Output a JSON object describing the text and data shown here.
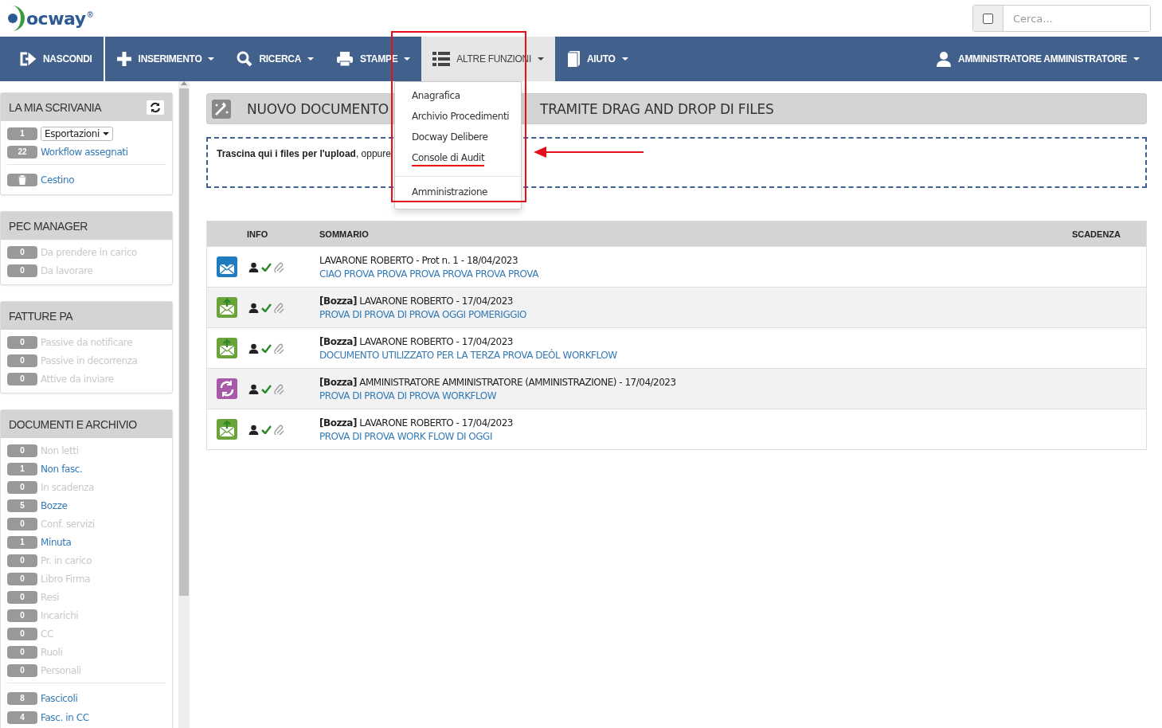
{
  "header": {
    "logo": "ocway",
    "logo_mark": "®",
    "search": {
      "placeholder": "Cerca...",
      "checked": false
    }
  },
  "nav": {
    "items": [
      {
        "label": "NASCONDI",
        "caret": false,
        "selected": false
      },
      {
        "label": "INSERIMENTO",
        "caret": true,
        "selected": false
      },
      {
        "label": "RICERCA",
        "caret": true,
        "selected": false
      },
      {
        "label": "STAMPE",
        "caret": true,
        "selected": false
      },
      {
        "label": "ALTRE FUNZIONI",
        "caret": true,
        "selected": true
      },
      {
        "label": "AIUTO",
        "caret": true,
        "selected": false
      }
    ],
    "user": {
      "label": "AMMINISTRATORE AMMINISTRATORE",
      "caret": true
    }
  },
  "menu": {
    "items": [
      {
        "label": "Anagrafica",
        "underlined": false,
        "divider_before": false
      },
      {
        "label": "Archivio Procedimenti",
        "underlined": false,
        "divider_before": false
      },
      {
        "label": "Docway Delibere",
        "underlined": false,
        "divider_before": false
      },
      {
        "label": "Console di Audit",
        "underlined": true,
        "divider_before": false
      },
      {
        "label": "Amministrazione",
        "underlined": false,
        "divider_before": true
      }
    ]
  },
  "sidebar": {
    "panels": [
      {
        "title": "LA MIA SCRIVANIA",
        "refresh": true,
        "items": [
          {
            "kind": "dropdown",
            "badge": "1",
            "label": "Esportazioni",
            "disabled": false,
            "divider_before": false
          },
          {
            "kind": "link",
            "badge": "22",
            "label": "Workflow assegnati",
            "disabled": false,
            "divider_before": false
          },
          {
            "kind": "trash",
            "label": "Cestino",
            "disabled": false,
            "divider_before": true
          }
        ]
      },
      {
        "title": "PEC MANAGER",
        "refresh": false,
        "items": [
          {
            "kind": "link",
            "badge": "0",
            "label": "Da prendere in carico",
            "disabled": true,
            "divider_before": false
          },
          {
            "kind": "link",
            "badge": "0",
            "label": "Da lavorare",
            "disabled": true,
            "divider_before": false
          }
        ]
      },
      {
        "title": "FATTURE PA",
        "refresh": false,
        "items": [
          {
            "kind": "link",
            "badge": "0",
            "label": "Passive da notificare",
            "disabled": true,
            "divider_before": false
          },
          {
            "kind": "link",
            "badge": "0",
            "label": "Passive in decorrenza",
            "disabled": true,
            "divider_before": false
          },
          {
            "kind": "link",
            "badge": "0",
            "label": "Attive da inviare",
            "disabled": true,
            "divider_before": false
          }
        ]
      },
      {
        "title": "DOCUMENTI E ARCHIVIO",
        "refresh": false,
        "items": [
          {
            "kind": "link",
            "badge": "0",
            "label": "Non letti",
            "disabled": true,
            "divider_before": false
          },
          {
            "kind": "link",
            "badge": "1",
            "label": "Non fasc.",
            "disabled": false,
            "divider_before": false
          },
          {
            "kind": "link",
            "badge": "0",
            "label": "In scadenza",
            "disabled": true,
            "divider_before": false
          },
          {
            "kind": "link",
            "badge": "5",
            "label": "Bozze",
            "disabled": false,
            "divider_before": false
          },
          {
            "kind": "link",
            "badge": "0",
            "label": "Conf. servizi",
            "disabled": true,
            "divider_before": false
          },
          {
            "kind": "link",
            "badge": "1",
            "label": "Minuta",
            "disabled": false,
            "divider_before": false
          },
          {
            "kind": "link",
            "badge": "0",
            "label": "Pr. in carico",
            "disabled": true,
            "divider_before": false
          },
          {
            "kind": "link",
            "badge": "0",
            "label": "Libro Firma",
            "disabled": true,
            "divider_before": false
          },
          {
            "kind": "link",
            "badge": "0",
            "label": "Resi",
            "disabled": true,
            "divider_before": false
          },
          {
            "kind": "link",
            "badge": "0",
            "label": "Incarichi",
            "disabled": true,
            "divider_before": false
          },
          {
            "kind": "link",
            "badge": "0",
            "label": "CC",
            "disabled": true,
            "divider_before": false
          },
          {
            "kind": "link",
            "badge": "0",
            "label": "Ruoli",
            "disabled": true,
            "divider_before": false
          },
          {
            "kind": "link",
            "badge": "0",
            "label": "Personali",
            "disabled": true,
            "divider_before": false
          },
          {
            "kind": "link",
            "badge": "8",
            "label": "Fascicoli",
            "disabled": false,
            "divider_before": true
          },
          {
            "kind": "link",
            "badge": "4",
            "label": "Fasc. in CC",
            "disabled": false,
            "divider_before": false
          }
        ]
      }
    ]
  },
  "title_bar": {
    "title_start": "NUOVO DOCUMENTO",
    "title_end": "TRAMITE DRAG AND DROP DI FILES"
  },
  "dropzone": {
    "text": "**Trascina qui i files per l'upload**, oppure"
  },
  "table": {
    "columns": [
      "INFO",
      "SOMMARIO",
      "SCADENZA"
    ],
    "rows": [
      {
        "kind": "incoming",
        "heading": "LAVARONE ROBERTO - Prot n. 1 - 18/04/2023",
        "subject": "CIAO PROVA PROVA PROVA PROVA PROVA PROVA"
      },
      {
        "kind": "draft",
        "heading": "**[Bozza]** LAVARONE ROBERTO - 17/04/2023",
        "subject": "PROVA DI PROVA DI PROVA OGGI POMERIGGIO"
      },
      {
        "kind": "draft",
        "heading": "**[Bozza]** LAVARONE ROBERTO - 17/04/2023",
        "subject": "DOCUMENTO UTILIZZATO PER LA TERZA PROVA DEÒL WORKFLOW"
      },
      {
        "kind": "workflow",
        "heading": "**[Bozza]** AMMINISTRATORE AMMINISTRATORE (AMMINISTRAZIONE) - 17/04/2023",
        "subject": "PROVA DI PROVA DI PROVA WORKFLOW"
      },
      {
        "kind": "draft",
        "heading": "**[Bozza]** LAVARONE ROBERTO - 17/04/2023",
        "subject": "PROVA DI PROVA WORK FLOW DI OGGI"
      }
    ]
  }
}
